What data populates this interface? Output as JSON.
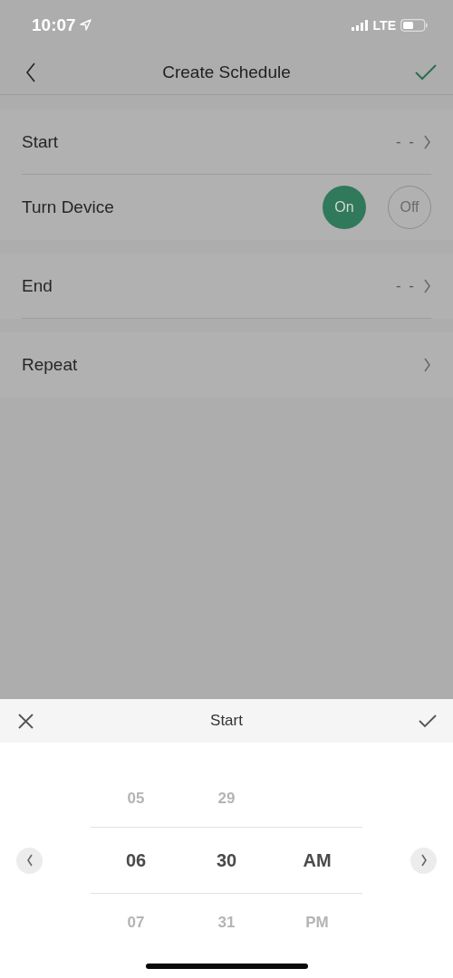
{
  "status_bar": {
    "time": "10:07",
    "network": "LTE"
  },
  "nav_bar": {
    "title": "Create Schedule"
  },
  "groups": [
    {
      "rows": [
        {
          "kind": "link",
          "label": "Start",
          "value": "- -"
        },
        {
          "kind": "toggle",
          "label": "Turn Device",
          "options": [
            {
              "label": "On",
              "selected": true
            },
            {
              "label": "Off",
              "selected": false
            }
          ]
        }
      ]
    },
    {
      "rows": [
        {
          "kind": "link",
          "label": "End",
          "value": "- -"
        }
      ]
    },
    {
      "rows": [
        {
          "kind": "link",
          "label": "Repeat"
        }
      ]
    }
  ],
  "picker": {
    "title": "Start",
    "columns": [
      {
        "above": "05",
        "current": "06",
        "below": "07"
      },
      {
        "above": "29",
        "current": "30",
        "below": "31"
      },
      {
        "current": "AM",
        "below": "PM"
      }
    ]
  }
}
